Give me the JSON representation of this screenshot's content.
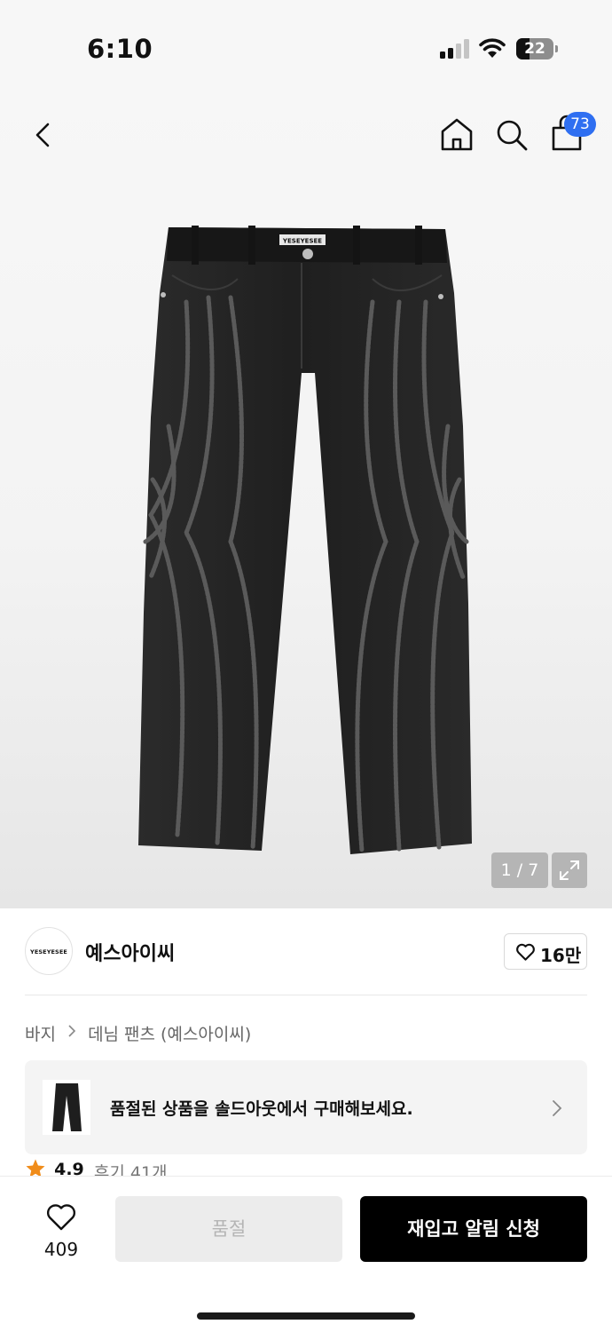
{
  "status_bar": {
    "time": "6:10",
    "battery": "22"
  },
  "header": {
    "cart_count": "73"
  },
  "gallery": {
    "counter": "1 / 7",
    "waistband_label": "YESEYESEE"
  },
  "brand": {
    "logo_text": "YESEYESEE",
    "name": "예스아이씨",
    "like_count": "16만"
  },
  "breadcrumb": {
    "items": [
      "바지",
      "데님 팬츠 (예스아이씨)"
    ]
  },
  "soldout_banner": {
    "text": "품절된 상품을 솔드아웃에서 구매해보세요."
  },
  "rating": {
    "score": "4.9",
    "reviews": "후기 41개"
  },
  "bottom_bar": {
    "wish_count": "409",
    "soldout_label": "품절",
    "restock_label": "재입고 알림 신청"
  },
  "colors": {
    "accent": "#2f6ff1",
    "star": "#f08c1a",
    "primary_button": "#000000"
  }
}
